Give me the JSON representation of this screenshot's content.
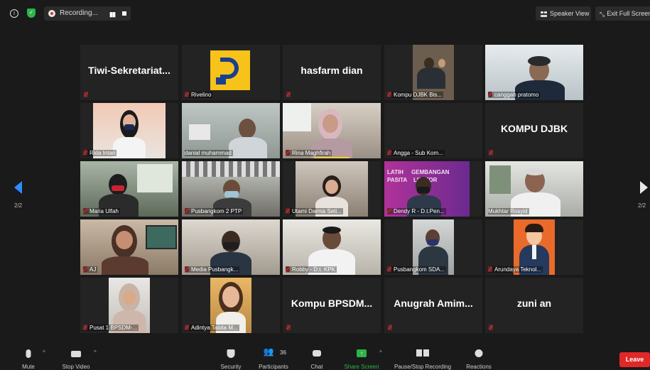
{
  "top": {
    "recording_label": "Recording...",
    "speaker_view": "Speaker View",
    "exit_full_screen": "Exit Full Screen"
  },
  "pager": {
    "left": "2/2",
    "right": "2/2"
  },
  "tiles": [
    {
      "big": "Tiwi-Sekretariat...",
      "name": ""
    },
    {
      "big": "",
      "name": "Rivelino"
    },
    {
      "big": "hasfarm dian",
      "name": ""
    },
    {
      "big": "",
      "name": "Kompu DJBK Bis..."
    },
    {
      "big": "",
      "name": "canggah pratomo"
    },
    {
      "big": "",
      "name": "Rida Intan"
    },
    {
      "big": "",
      "name": "danial muhammad"
    },
    {
      "big": "",
      "name": "Rina Maghfirah"
    },
    {
      "big": "",
      "name": "Angga - Sub Kom..."
    },
    {
      "big": "KOMPU DJBK",
      "name": ""
    },
    {
      "big": "",
      "name": "Maria Ulfah"
    },
    {
      "big": "",
      "name": "Pusbangkom 2 PTP"
    },
    {
      "big": "",
      "name": "Utami Darma Seti..."
    },
    {
      "big": "",
      "name": "Dendy R - D.t.Pen..."
    },
    {
      "big": "",
      "name": "Mukhtar Rosyid"
    },
    {
      "big": "",
      "name": "AJ"
    },
    {
      "big": "",
      "name": "Media Pusbangk..."
    },
    {
      "big": "",
      "name": "Robby - D.t. KPK"
    },
    {
      "big": "",
      "name": "Pusbangkom SDA..."
    },
    {
      "big": "",
      "name": "Arundaya Teknol..."
    },
    {
      "big": "",
      "name": "Pusat 1 BPSDM-..."
    },
    {
      "big": "",
      "name": "Adintya Tabita M..."
    },
    {
      "big": "Kompu  BPSDM...",
      "name": ""
    },
    {
      "big": "Anugrah  Amim...",
      "name": ""
    },
    {
      "big": "zuni an",
      "name": ""
    }
  ],
  "toolbar": {
    "mute": "Mute",
    "stop_video": "Stop Video",
    "security": "Security",
    "participants": "Participants",
    "participants_count": "36",
    "chat": "Chat",
    "share_screen": "Share Screen",
    "pause_stop_recording": "Pause/Stop Recording",
    "reactions": "Reactions",
    "leave": "Leave"
  },
  "colors": {
    "background": "#1a1a1a",
    "tile": "#232323",
    "share_green": "#2fb34a",
    "leave_red": "#e02828",
    "nav_blue": "#2d8cff"
  }
}
